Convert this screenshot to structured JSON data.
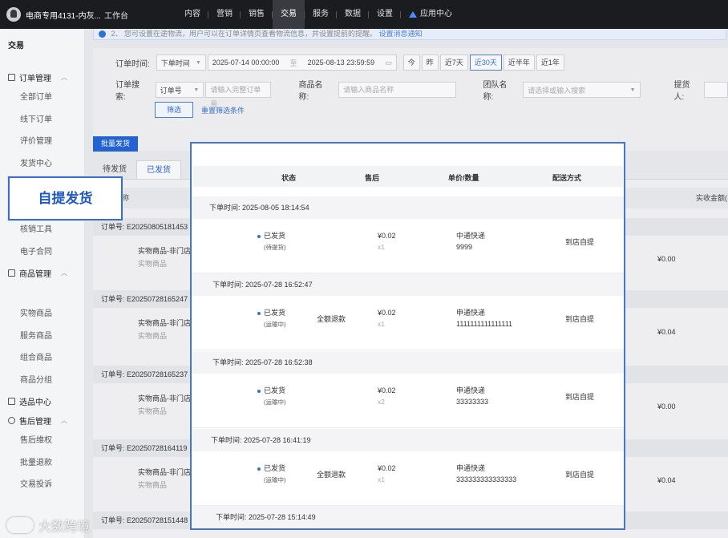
{
  "topbar": {
    "brand": "电商专用4131-内灰...",
    "workbench": "工作台",
    "nav": [
      "内容",
      "营销",
      "销售",
      "交易",
      "服务",
      "数据",
      "设置"
    ],
    "active": "交易",
    "app_center": "应用中心"
  },
  "sidebar": {
    "title": "交易",
    "group_order": "订单管理",
    "order_items": [
      "全部订单",
      "线下订单",
      "评价管理",
      "发货中心"
    ],
    "order_items_2": [
      "核销工具",
      "电子合同"
    ],
    "group_goods": "商品管理",
    "goods_items": [
      "实物商品",
      "服务商品",
      "组合商品",
      "商品分组"
    ],
    "group_select": "选品中心",
    "group_aftersale": "售后管理",
    "aftersale_items": [
      "售后维权",
      "批量退款",
      "交易投诉"
    ]
  },
  "notice": {
    "text": "2、 您可设置在途物流，用户可以在订单详情页查看物流信息，并设置提前的提醒。",
    "link": "设置消息通知"
  },
  "filters": {
    "order_time_label": "订单时间:",
    "order_time_type": "下单时间",
    "start": "2025-07-14 00:00:00",
    "to": "至",
    "end": "2025-08-13 23:59:59",
    "quick": [
      "今",
      "昨",
      "近7天",
      "近30天",
      "近半年",
      "近1年"
    ],
    "quick_active": "近30天",
    "search_label": "订单搜索:",
    "search_type": "订单号",
    "search_placeholder": "请输入完整订单号",
    "goods_label": "商品名称:",
    "goods_placeholder": "请输入商品名称",
    "group_label": "团队名称:",
    "group_placeholder": "请选择或输入搜索",
    "picker_label": "提货人:",
    "filter_btn": "筛选",
    "reset_link": "重置筛选条件"
  },
  "batch_ship": "批量发货",
  "subtabs": [
    "待发货",
    "已发货"
  ],
  "subtab_active": "已发货",
  "list": {
    "col_name": "称",
    "col_amount": "实收金额(",
    "orders": [
      {
        "no": "订单号: E20250805181453",
        "goods": "实物商品-非门店",
        "type": "实物商品",
        "amount": "¥0.00"
      },
      {
        "no": "订单号: E20250728165247",
        "goods": "实物商品-非门店",
        "type": "实物商品",
        "amount": "¥0.04"
      },
      {
        "no": "订单号: E20250728165237",
        "goods": "实物商品-非门店",
        "type": "实物商品",
        "amount": "¥0.00"
      },
      {
        "no": "订单号: E20250728164119",
        "goods": "实物商品-非门店",
        "type": "实物商品",
        "amount": "¥0.04"
      },
      {
        "no": "订单号: E20250728151448",
        "goods": "",
        "type": "",
        "amount": ""
      }
    ]
  },
  "callout": "自提发货",
  "panel": {
    "headers": {
      "status": "状态",
      "aftersale": "售后",
      "price_qty": "单价/数量",
      "delivery": "配送方式"
    },
    "orders": [
      {
        "time": "下单时间:  2025-08-05 18:14:54",
        "status": "已发货",
        "sub": "(待提货)",
        "refund": "",
        "price": "¥0.02",
        "qty": "x1",
        "courier": "中通快递",
        "track": "9999",
        "delivery": "到店自提"
      },
      {
        "time": "下单时间:  2025-07-28 16:52:47",
        "status": "已发货",
        "sub": "(运输中)",
        "refund": "全额退款",
        "price": "¥0.02",
        "qty": "x1",
        "courier": "申通快递",
        "track": "1111111111111111",
        "delivery": "到店自提"
      },
      {
        "time": "下单时间:  2025-07-28 16:52:38",
        "status": "已发货",
        "sub": "(运输中)",
        "refund": "",
        "price": "¥0.02",
        "qty": "x2",
        "courier": "申通快递",
        "track": "33333333",
        "delivery": "到店自提"
      },
      {
        "time": "下单时间:  2025-07-28 16:41:19",
        "status": "已发货",
        "sub": "(运输中)",
        "refund": "全额退款",
        "price": "¥0.02",
        "qty": "x1",
        "courier": "申通快递",
        "track": "333333333333333",
        "delivery": "到店自提"
      },
      {
        "time": "下单时间:  2025-07-28 15:14:49",
        "status": "",
        "sub": "",
        "refund": "",
        "price": "",
        "qty": "",
        "courier": "",
        "track": "",
        "delivery": ""
      }
    ]
  },
  "watermark": "大数跨境"
}
